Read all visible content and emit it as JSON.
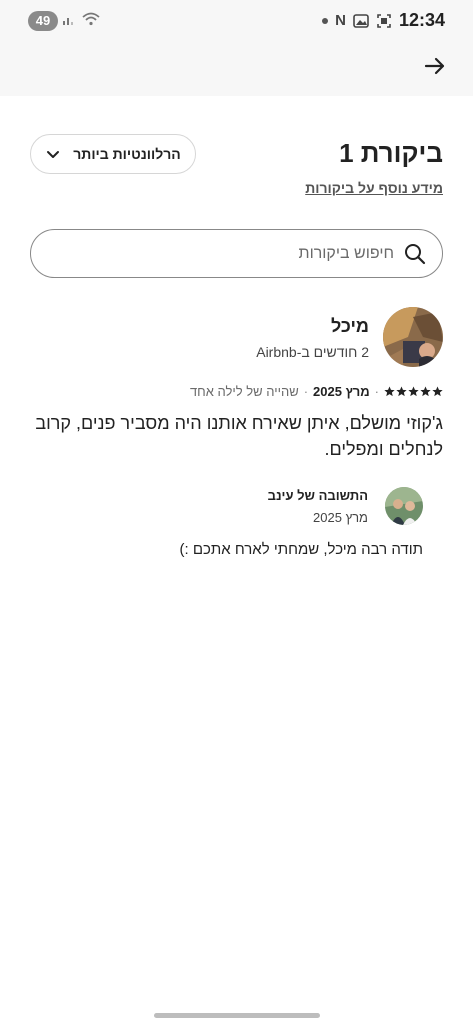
{
  "status_bar": {
    "battery": "49",
    "time": "12:34",
    "n_icon_text": "N"
  },
  "header": {
    "back_icon": "arrow-right-icon"
  },
  "reviews": {
    "title": "ביקורת 1",
    "more_info_link": "מידע נוסף על ביקורות",
    "sort_label": "הרלוונטיות ביותר"
  },
  "search": {
    "placeholder": "חיפוש ביקורות",
    "value": ""
  },
  "review": {
    "reviewer_name": "מיכל",
    "reviewer_tenure": "2 חודשים ב-Airbnb",
    "rating": 5,
    "date": "מרץ 2025",
    "separator": "·",
    "stay": "שהייה של לילה אחד",
    "text": "ג'קוזי מושלם, איתן שאירח אותנו היה מסביר פנים, קרוב לנחלים ומפלים."
  },
  "host_response": {
    "title": "התשובה של עינב",
    "date": "מרץ 2025",
    "text": "תודה רבה מיכל, שמחתי לארח אתכם :)"
  },
  "colors": {
    "header_bg": "#f7f7f7",
    "text_primary": "#222222",
    "text_secondary": "#6a6a6a",
    "border": "#d6d6d6"
  }
}
